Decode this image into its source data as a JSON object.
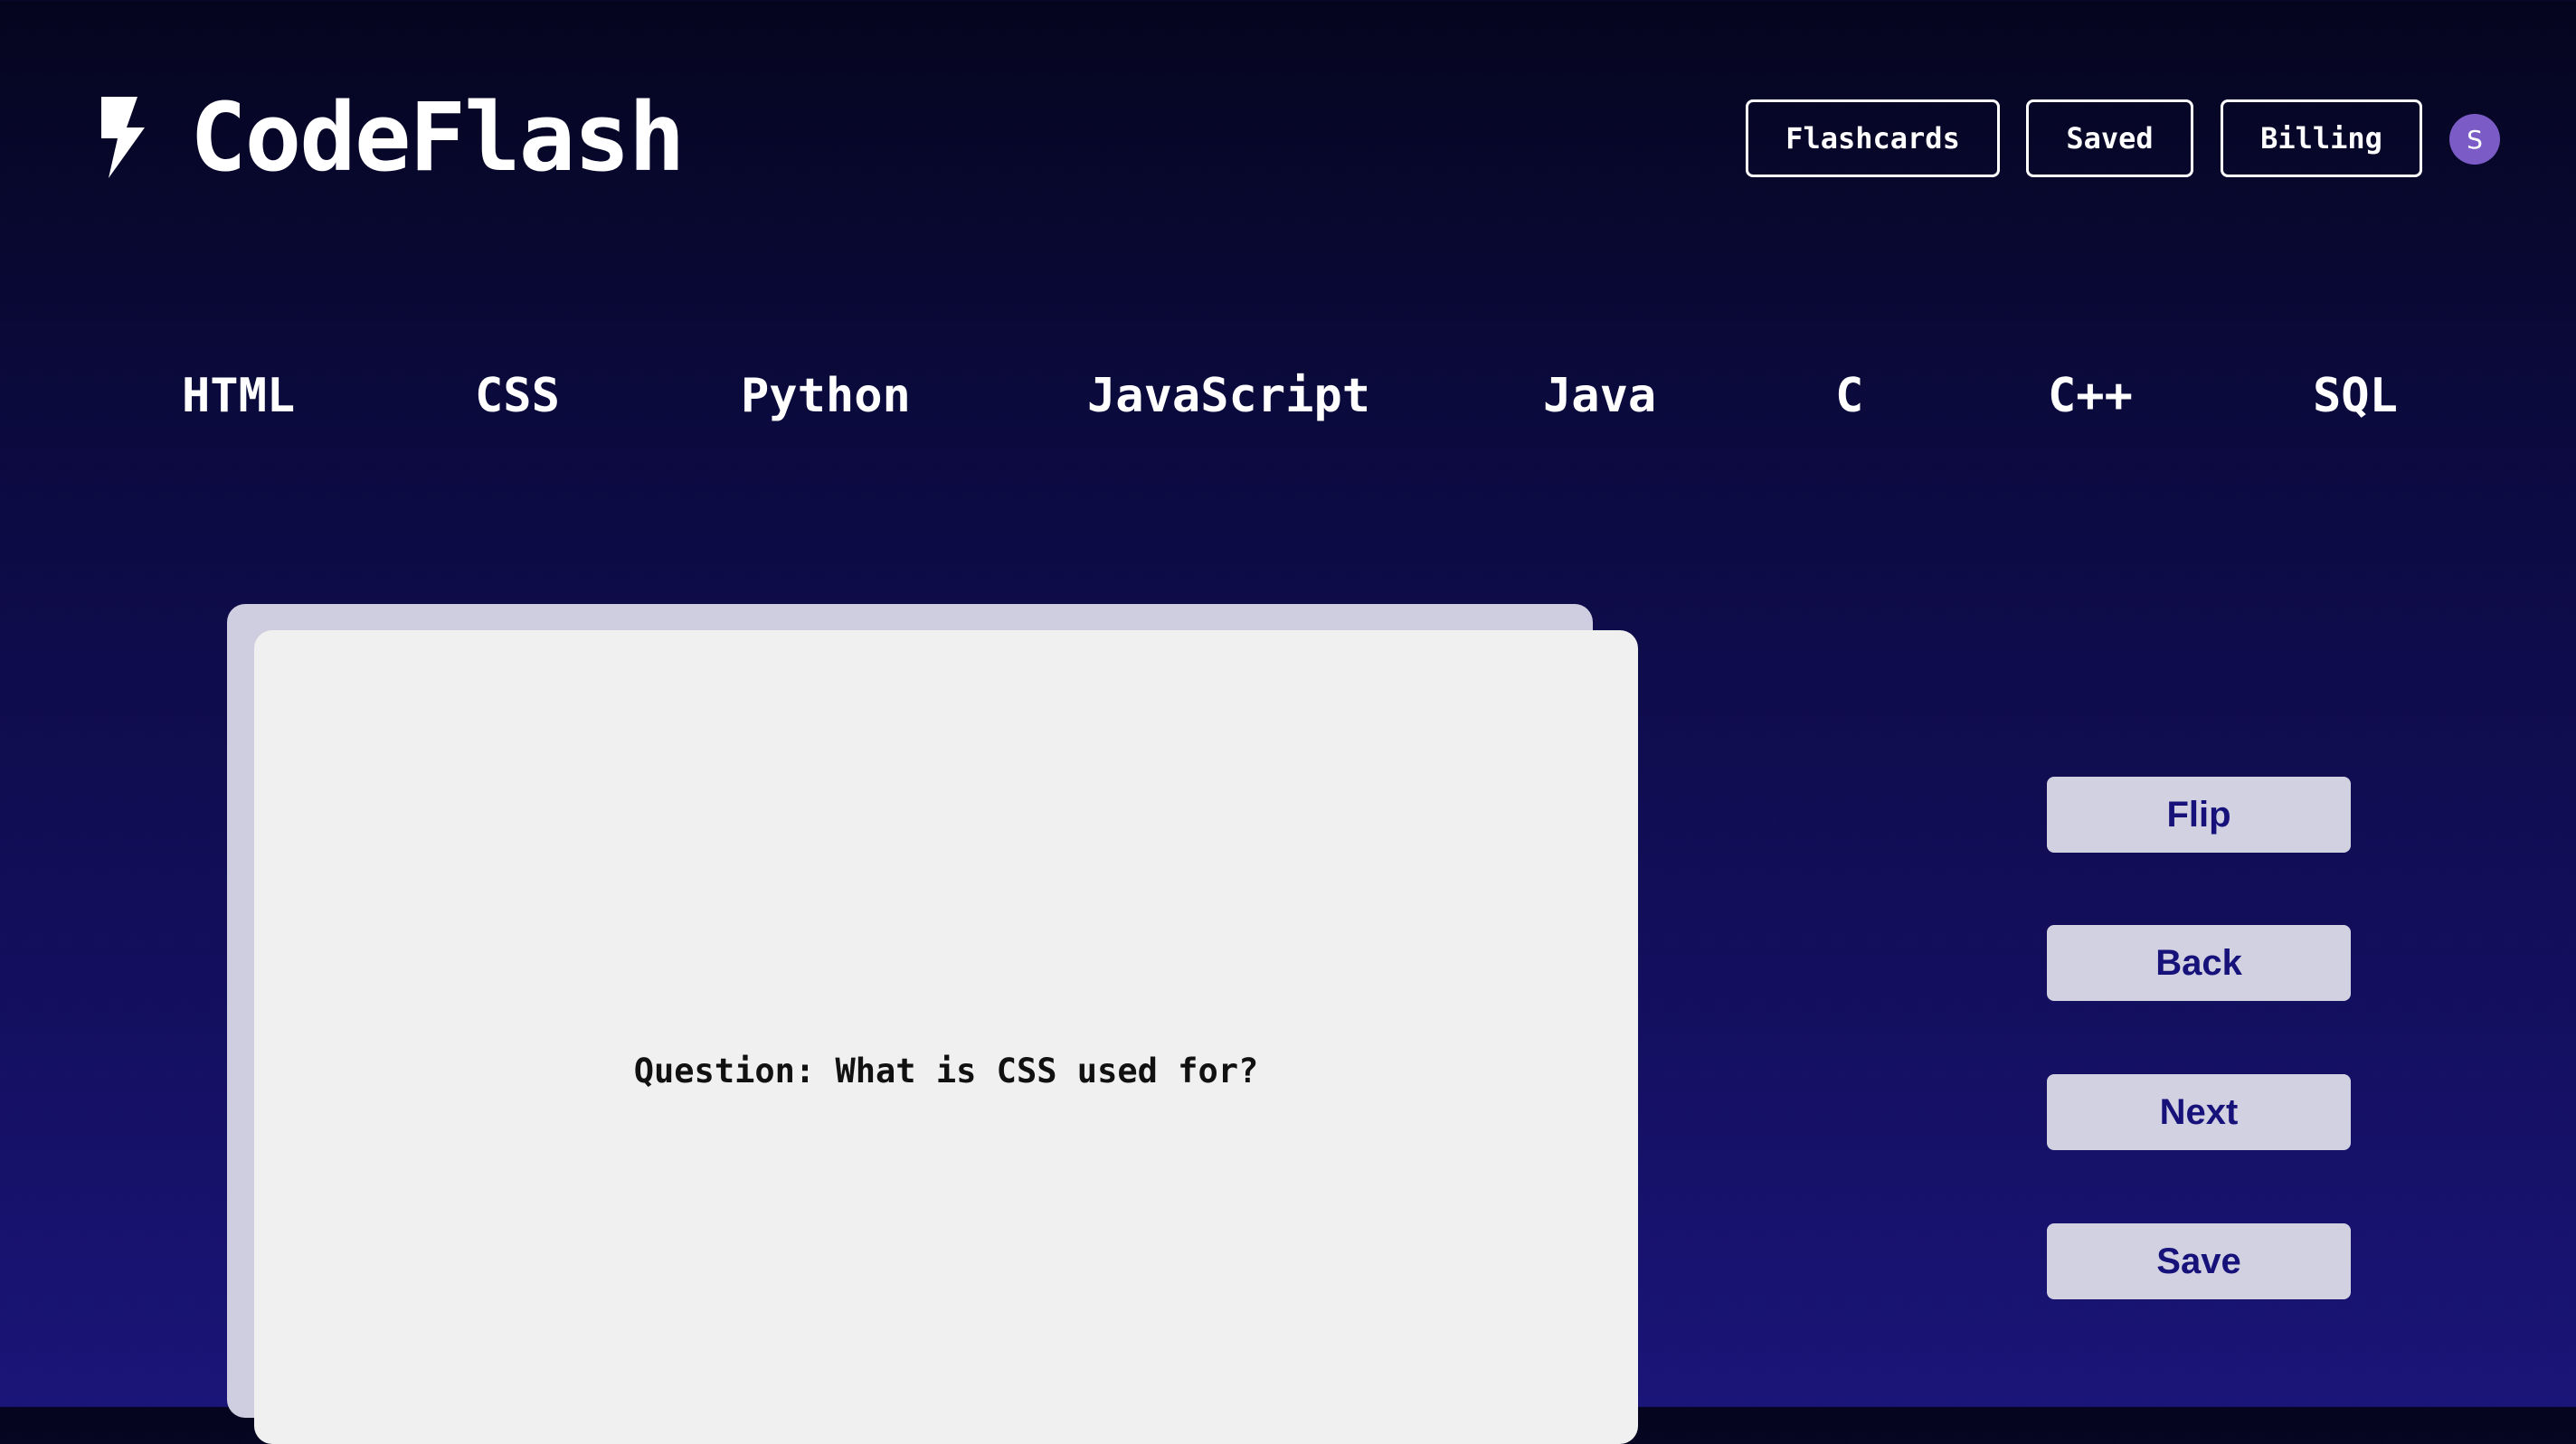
{
  "header": {
    "logo_icon": "lightning-bolt-icon",
    "app_name": "CodeFlash",
    "nav": {
      "flashcards": "Flashcards",
      "saved": "Saved",
      "billing": "Billing"
    },
    "avatar_initial": "S"
  },
  "languages": [
    "HTML",
    "CSS",
    "Python",
    "JavaScript",
    "Java",
    "C",
    "C++",
    "SQL"
  ],
  "card": {
    "text": "Question: What is CSS used for?"
  },
  "actions": {
    "flip": "Flip",
    "back": "Back",
    "next": "Next",
    "save": "Save"
  },
  "colors": {
    "background_top": "#05051f",
    "background_bottom": "#1a1578",
    "avatar": "#7b5cc6",
    "card": "#f0f0f0",
    "card_stack": "#cfcde0",
    "action_button": "#d2d1e2",
    "action_text": "#17127a"
  }
}
